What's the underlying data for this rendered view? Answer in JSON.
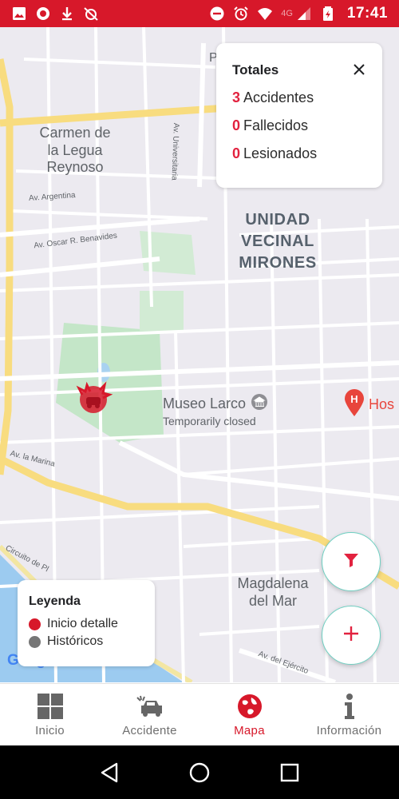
{
  "status_bar": {
    "icons_left": [
      "image-icon",
      "record-icon",
      "download-icon",
      "alarm-off-icon"
    ],
    "icons_right": [
      "do-not-disturb-icon",
      "alarm-icon",
      "wifi-icon",
      "signal-icon",
      "battery-icon"
    ],
    "network": "4G",
    "time": "17:41",
    "background_color": "#d7182a"
  },
  "map": {
    "place_labels": [
      "Carmen de\nla Legua\nReynoso",
      "Magdalena\ndel Mar"
    ],
    "district_label": "UNIDAD\nVECINAL\nMIRONES",
    "street_labels": [
      "Av. Universitaria",
      "Av. Argentina",
      "Av. Oscar R. Benavides",
      "Av. la Marina",
      "Circuito de Pl",
      "Av. del Ejército",
      "P"
    ],
    "poi": {
      "museum_name": "Museo Larco",
      "museum_status": "Temporarily closed",
      "hospital_name": "Hos"
    },
    "google_logo": "Google"
  },
  "totals": {
    "title": "Totales",
    "close_label": "×",
    "rows": [
      {
        "count": "3",
        "label": "Accidentes"
      },
      {
        "count": "0",
        "label": "Fallecidos"
      },
      {
        "count": "0",
        "label": "Lesionados"
      }
    ]
  },
  "legend": {
    "title": "Leyenda",
    "items": [
      {
        "label": "Inicio detalle",
        "color": "#d7182a"
      },
      {
        "label": "Históricos",
        "color": "#767676"
      }
    ]
  },
  "fabs": {
    "filter_icon": "filter-icon",
    "add_icon": "plus-icon",
    "accent": "#e2223f"
  },
  "bottom_nav": {
    "items": [
      {
        "label": "Inicio",
        "icon": "grid-icon",
        "active": false
      },
      {
        "label": "Accidente",
        "icon": "car-crash-icon",
        "active": false
      },
      {
        "label": "Mapa",
        "icon": "globe-icon",
        "active": true
      },
      {
        "label": "Información",
        "icon": "info-icon",
        "active": false
      }
    ],
    "active_color": "#d7182a",
    "inactive_color": "#6f6f6f"
  },
  "system_nav": {
    "buttons": [
      "back-icon",
      "home-icon",
      "recents-icon"
    ]
  }
}
